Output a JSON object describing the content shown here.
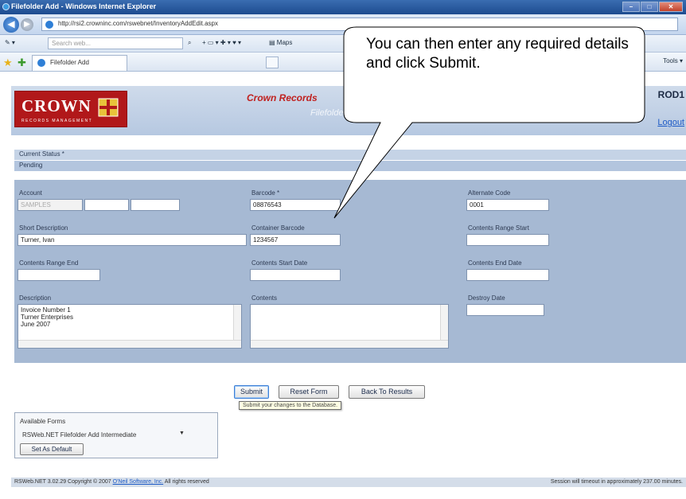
{
  "browser": {
    "window_title": "Filefolder Add - Windows Internet Explorer",
    "url": "http://rsi2.crowninc.com/rswebnet/InventoryAddEdit.aspx",
    "search_placeholder": "Search web...",
    "toolbar_maps": "Maps",
    "tab_title": "Filefolder Add",
    "tools_menu": "Tools"
  },
  "header": {
    "logo_text": "CROWN",
    "logo_subtext": "RECORDS MANAGEMENT",
    "app_title": "Crown Records",
    "page_subtitle": "Filefolder",
    "user": "ROD1",
    "logout": "Logout"
  },
  "status": {
    "label": "Current Status *",
    "value": "Pending"
  },
  "form": {
    "account_label": "Account",
    "account_value": "SAMPLES",
    "account_sub1": "",
    "account_sub2": "",
    "barcode_label": "Barcode *",
    "barcode_value": "08876543",
    "alternate_code_label": "Alternate Code",
    "alternate_code_value": "0001",
    "short_description_label": "Short Description",
    "short_description_value": "Turner, Ivan",
    "container_barcode_label": "Container Barcode",
    "container_barcode_value": "1234567",
    "contents_range_start_label": "Contents Range Start",
    "contents_range_start_value": "",
    "contents_range_end_label": "Contents Range End",
    "contents_range_end_value": "",
    "contents_start_date_label": "Contents Start Date",
    "contents_start_date_value": "",
    "contents_end_date_label": "Contents End Date",
    "contents_end_date_value": "",
    "description_label": "Description",
    "description_lines": [
      "Invoice Number 1",
      "Turner Enterprises",
      "June 2007"
    ],
    "contents_label": "Contents",
    "contents_value": "",
    "destroy_date_label": "Destroy Date",
    "destroy_date_value": ""
  },
  "actions": {
    "submit": "Submit",
    "reset": "Reset Form",
    "back": "Back To Results",
    "submit_tooltip": "Submit your changes to the Database."
  },
  "available_forms": {
    "title": "Available Forms",
    "selected": "RSWeb.NET Filefolder Add Intermediate",
    "set_default": "Set As Default"
  },
  "footer": {
    "copyright_prefix": "RSWeb.NET 3.02.29 Copyright © 2007",
    "company_link": "O'Neil Software, Inc.",
    "copyright_suffix": "All rights reserved",
    "session": "Session will timeout in approximately 237.00 minutes."
  },
  "callout": {
    "text": "You can then enter any required details and click Submit."
  },
  "colors": {
    "brand_red": "#b1181a",
    "form_panel": "#a6b9d3",
    "link_blue": "#1e5bc6"
  }
}
